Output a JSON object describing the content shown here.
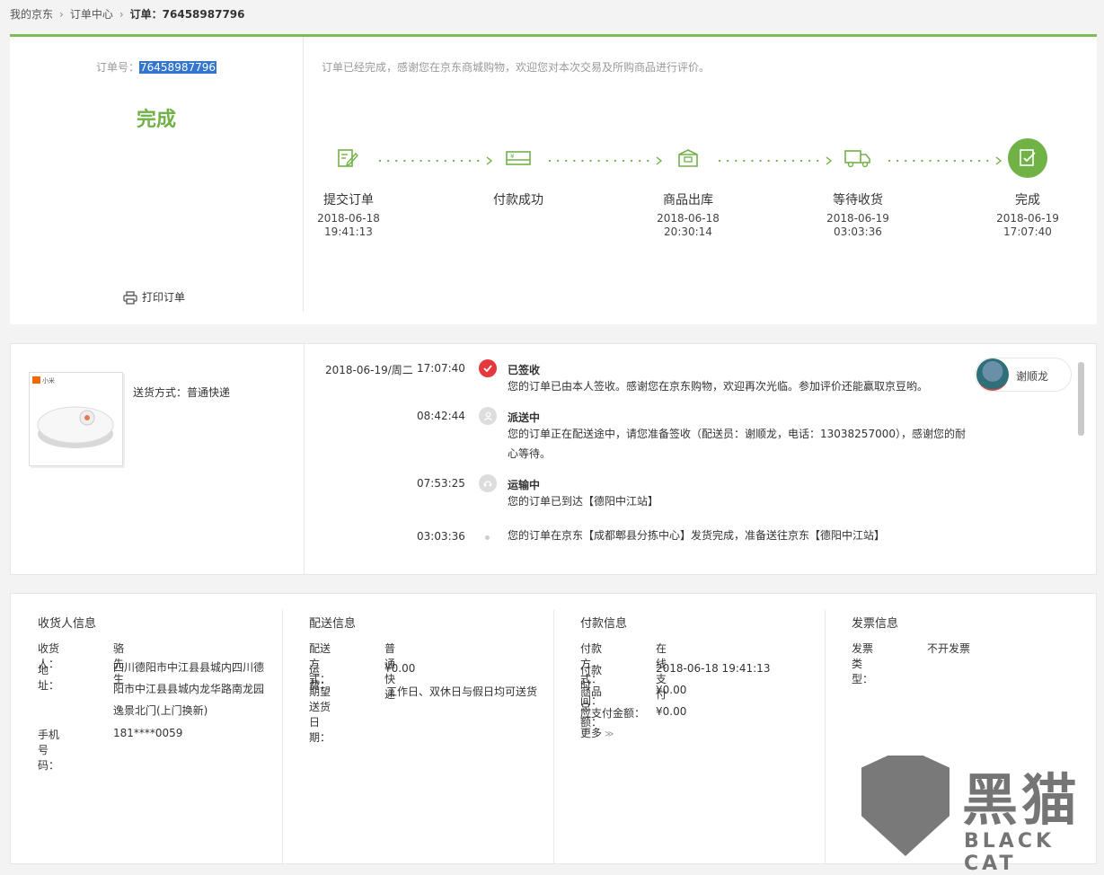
{
  "breadcrumb": {
    "home": "我的京东",
    "orders": "订单中心",
    "current": "订单：76458987796"
  },
  "status": {
    "order_label": "订单号：",
    "order_number": "76458987796",
    "state": "完成",
    "message": "订单已经完成，感谢您在京东商城购物，欢迎您对本次交易及所购商品进行评价。",
    "print_label": "打印订单",
    "steps": [
      {
        "name": "提交订单",
        "date": "2018-06-18",
        "time": "19:41:13",
        "icon": "edit-order-icon"
      },
      {
        "name": "付款成功",
        "date": "",
        "time": "",
        "icon": "payment-card-icon"
      },
      {
        "name": "商品出库",
        "date": "2018-06-18",
        "time": "20:30:14",
        "icon": "package-box-icon"
      },
      {
        "name": "等待收货",
        "date": "2018-06-19",
        "time": "03:03:36",
        "icon": "delivery-truck-icon"
      },
      {
        "name": "完成",
        "date": "2018-06-19",
        "time": "17:07:40",
        "icon": "completed-check-icon"
      }
    ]
  },
  "shipment": {
    "product_brand": "小米",
    "method": "送货方式：普通快递",
    "courier_name": "谢顺龙",
    "tracking": [
      {
        "date": "2018-06-19/周二",
        "time": "17:07:40",
        "title": "已签收",
        "desc": "您的订单已由本人签收。感谢您在京东购物，欢迎再次光临。参加评价还能赢取京豆哟。",
        "icon": "signed-check-icon"
      },
      {
        "date": "",
        "time": "08:42:44",
        "title": "派送中",
        "desc": "您的订单正在配送途中，请您准备签收（配送员：谢顺龙，电话：13038257000），感谢您的耐心等待。",
        "icon": "courier-icon"
      },
      {
        "date": "",
        "time": "07:53:25",
        "title": "运输中",
        "desc": "您的订单已到达【德阳中江站】",
        "icon": "transit-icon"
      },
      {
        "date": "",
        "time": "03:03:36",
        "title": "",
        "desc": "您的订单在京东【成都郫县分拣中心】发货完成，准备送往京东【德阳中江站】",
        "icon": "dot-icon"
      }
    ]
  },
  "info": {
    "receiver": {
      "title": "收货人信息",
      "name_k": "收货人：",
      "name_v": "骆先生",
      "addr_k": "地址：",
      "addr_v": "四川德阳市中江县县城内四川德阳市中江县县城内龙华路南龙园逸景北门(上门换新)",
      "phone_k": "手机号码：",
      "phone_v": "181****0059"
    },
    "delivery": {
      "title": "配送信息",
      "method_k": "配送方式：",
      "method_v": "普通快递",
      "fee_k": "运费：",
      "fee_v": "¥0.00",
      "date_k": "期望送货日期：",
      "date_v": "工作日、双休日与假日均可送货"
    },
    "payment": {
      "title": "付款信息",
      "method_k": "付款方式：",
      "method_v": "在线支付",
      "time_k": "付款时间：",
      "time_v": "2018-06-18 19:41:13",
      "total_k": "商品总额：",
      "total_v": "¥0.00",
      "due_k": "应支付金额：",
      "due_v": "¥0.00",
      "more": "更多"
    },
    "invoice": {
      "title": "发票信息",
      "type_k": "发票类型：",
      "type_v": "不开发票"
    }
  },
  "watermark": {
    "cn": "黑猫",
    "en": "BLACK CAT"
  },
  "colors": {
    "accent": "#71b247",
    "alert": "#e4393c",
    "highlight": "#3376d0"
  }
}
